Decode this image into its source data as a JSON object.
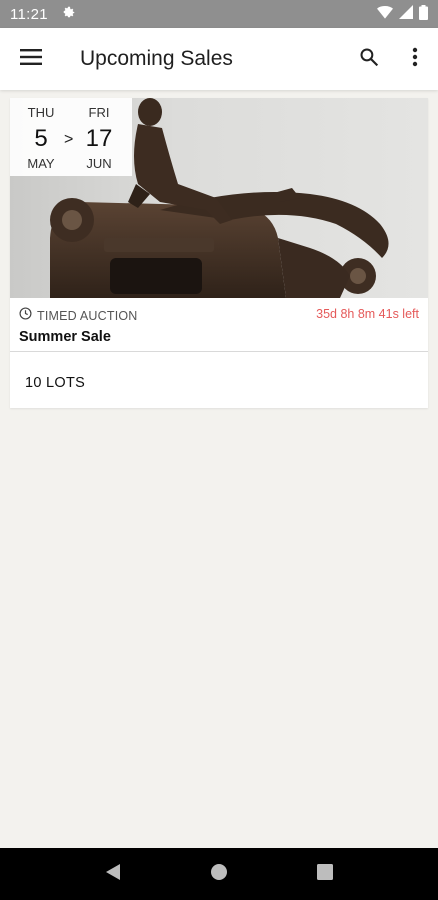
{
  "status_bar": {
    "time": "11:21",
    "icons": [
      "settings-icon",
      "wifi-icon",
      "signal-icon",
      "battery-icon"
    ]
  },
  "app_bar": {
    "title": "Upcoming Sales",
    "icons": [
      "menu-icon",
      "search-icon",
      "more-vert-icon"
    ]
  },
  "sale": {
    "start": {
      "dow": "THU",
      "day": "5",
      "month": "MAY"
    },
    "range_arrow": ">",
    "end": {
      "dow": "FRI",
      "day": "17",
      "month": "JUN"
    },
    "type": "TIMED AUCTION",
    "countdown": "35d 8h 8m 41s left",
    "name": "Summer Sale",
    "lots": "10 LOTS",
    "countdown_color": "#e55a5a"
  },
  "nav_bar": {
    "icons": [
      "back-icon",
      "home-icon",
      "recents-icon"
    ]
  }
}
